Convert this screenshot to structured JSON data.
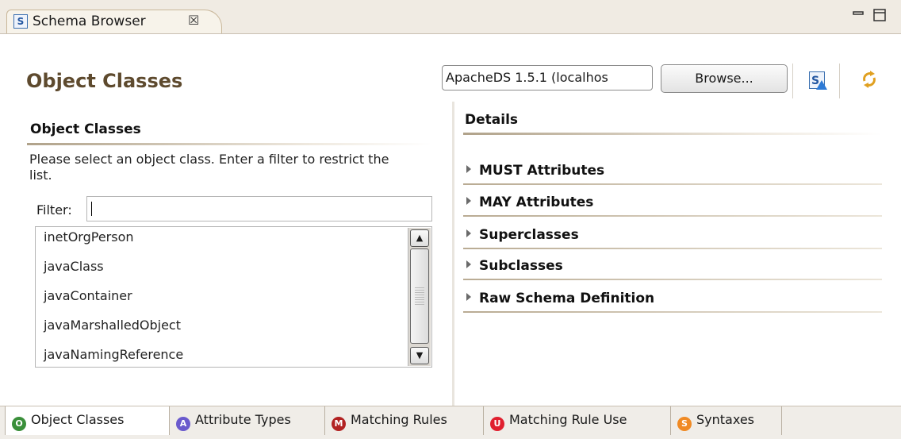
{
  "view": {
    "tab_title": "Schema Browser",
    "close_glyph": "☒",
    "minimize_glyph": "▭",
    "maximize_glyph": "□"
  },
  "header": {
    "title": "Object Classes",
    "server_value": "ApacheDS 1.5.1 (localhos",
    "browse_label": "Browse...",
    "browse_mnemonic_display": "Browse..."
  },
  "left": {
    "section_title": "Object Classes",
    "description": "Please select an object class. Enter a filter to restrict the list.",
    "filter_label": "Filter:",
    "filter_value": "",
    "items": [
      "inetOrgPerson",
      "javaClass",
      "javaContainer",
      "javaMarshalledObject",
      "javaNamingReference"
    ]
  },
  "right": {
    "section_title": "Details",
    "rows": [
      "MUST Attributes",
      "MAY Attributes",
      "Superclasses",
      "Subclasses",
      "Raw Schema Definition"
    ]
  },
  "bottom_tabs": [
    {
      "label": "Object Classes",
      "icon": "O",
      "color": "#3a8f3a"
    },
    {
      "label": "Attribute Types",
      "icon": "A",
      "color": "#6a5acd"
    },
    {
      "label": "Matching Rules",
      "icon": "M",
      "color": "#b22222"
    },
    {
      "label": "Matching Rule Use",
      "icon": "U",
      "color": "#e0202f"
    },
    {
      "label": "Syntaxes",
      "icon": "S",
      "color": "#f08a24"
    }
  ]
}
